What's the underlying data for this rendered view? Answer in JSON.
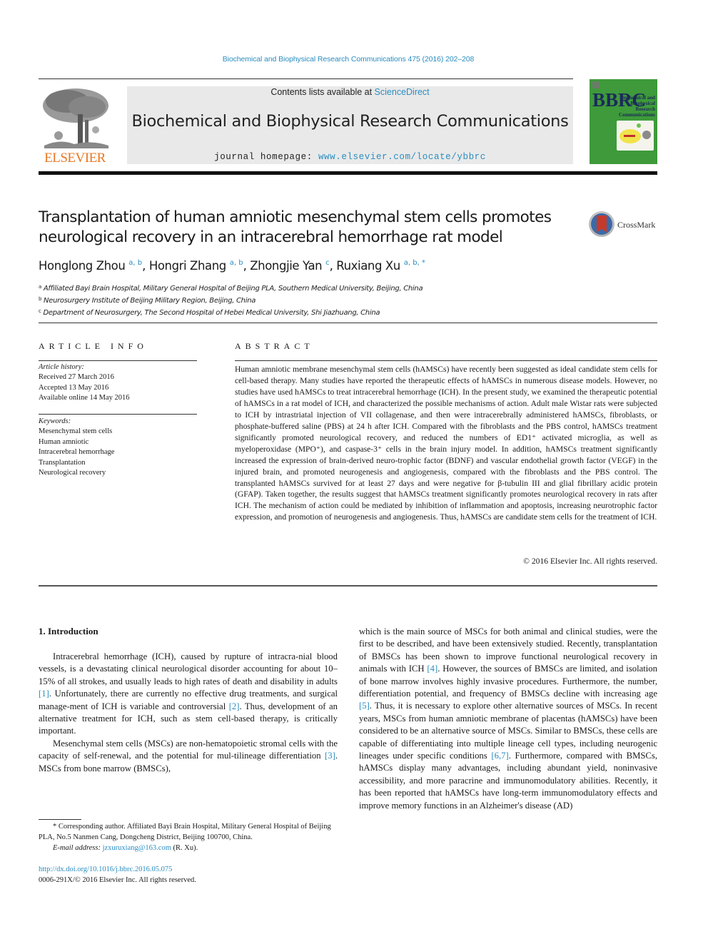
{
  "header": {
    "journal_ref": "Biochemical and Biophysical Research Communications 475 (2016) 202–208",
    "publisher_logo_text": "ELSEVIER",
    "contents_prefix": "Contents lists available at ",
    "contents_link": "ScienceDirect",
    "journal_name": "Biochemical and Biophysical Research Communications",
    "homepage_prefix": "journal homepage: ",
    "homepage_link": "www.elsevier.com/locate/ybbrc",
    "cover": {
      "letters": "BBRC",
      "title_lines": [
        "Biochemical and",
        "Biophysical",
        "Research",
        "Communications"
      ]
    },
    "colors": {
      "link": "#2a8dc0",
      "elsevier_orange": "#e87722",
      "cover_green": "#3e9a3a",
      "masthead_gray": "#e9e9e9"
    }
  },
  "article": {
    "title": "Transplantation of human amniotic mesenchymal stem cells promotes neurological recovery in an intracerebral hemorrhage rat model",
    "crossmark_label": "CrossMark",
    "authors": [
      {
        "name": "Honglong Zhou",
        "sup": "a, b"
      },
      {
        "name": "Hongri Zhang",
        "sup": "a, b"
      },
      {
        "name": "Zhongjie Yan",
        "sup": "c"
      },
      {
        "name": "Ruxiang Xu",
        "sup": "a, b, *"
      }
    ],
    "affiliations": [
      {
        "key": "a",
        "text": "Affiliated Bayi Brain Hospital, Military General Hospital of Beijing PLA, Southern Medical University, Beijing, China"
      },
      {
        "key": "b",
        "text": "Neurosurgery Institute of Beijing Military Region, Beijing, China"
      },
      {
        "key": "c",
        "text": "Department of Neurosurgery, The Second Hospital of Hebei Medical University, Shi Jiazhuang, China"
      }
    ]
  },
  "article_info": {
    "label": "ARTICLE INFO",
    "history_label": "Article history:",
    "history": [
      "Received 27 March 2016",
      "Accepted 13 May 2016",
      "Available online 14 May 2016"
    ],
    "keywords_label": "Keywords:",
    "keywords": [
      "Mesenchymal stem cells",
      "Human amniotic",
      "Intracerebral hemorrhage",
      "Transplantation",
      "Neurological recovery"
    ]
  },
  "abstract": {
    "label": "ABSTRACT",
    "text": "Human amniotic membrane mesenchymal stem cells (hAMSCs) have recently been suggested as ideal candidate stem cells for cell-based therapy. Many studies have reported the therapeutic effects of hAMSCs in numerous disease models. However, no studies have used hAMSCs to treat intracerebral hemorrhage (ICH). In the present study, we examined the therapeutic potential of hAMSCs in a rat model of ICH, and characterized the possible mechanisms of action. Adult male Wistar rats were subjected to ICH by intrastriatal injection of VII collagenase, and then were intracerebrally administered hAMSCs, fibroblasts, or phosphate-buffered saline (PBS) at 24 h after ICH. Compared with the fibroblasts and the PBS control, hAMSCs treatment significantly promoted neurological recovery, and reduced the numbers of ED1⁺ activated microglia, as well as myeloperoxidase (MPO⁺), and caspase-3⁺ cells in the brain injury model. In addition, hAMSCs treatment significantly increased the expression of brain-derived neuro-trophic factor (BDNF) and vascular endothelial growth factor (VEGF) in the injured brain, and promoted neurogenesis and angiogenesis, compared with the fibroblasts and the PBS control. The transplanted hAMSCs survived for at least 27 days and were negative for β-tubulin III and glial fibrillary acidic protein (GFAP). Taken together, the results suggest that hAMSCs treatment significantly promotes neurological recovery in rats after ICH. The mechanism of action could be mediated by inhibition of inflammation and apoptosis, increasing neurotrophic factor expression, and promotion of neurogenesis and angiogenesis. Thus, hAMSCs are candidate stem cells for the treatment of ICH.",
    "copyright": "© 2016 Elsevier Inc. All rights reserved."
  },
  "body": {
    "section_heading": "1.  Introduction",
    "left_col": {
      "p1_a": "Intracerebral hemorrhage (ICH), caused by rupture of intracra-nial blood vessels, is a devastating clinical neurological disorder accounting for about 10–15% of all strokes, and usually leads to high rates of death and disability in adults ",
      "ref1": "[1]",
      "p1_b": ". Unfortunately, there are currently no effective drug treatments, and surgical manage-ment of ICH is variable and controversial ",
      "ref2": "[2]",
      "p1_c": ". Thus, development of an alternative treatment for ICH, such as stem cell-based therapy, is critically important.",
      "p2_a": "Mesenchymal stem cells (MSCs) are non-hematopoietic stromal cells with the capacity of self-renewal, and the potential for mul-tilineage differentiation ",
      "ref3": "[3]",
      "p2_b": ". MSCs from bone marrow (BMSCs),"
    },
    "right_col": {
      "t_a": "which is the main source of MSCs for both animal and clinical studies, were the first to be described, and have been extensively studied. Recently, transplantation of BMSCs has been shown to improve functional neurological recovery in animals with ICH ",
      "ref4": "[4]",
      "t_b": ". However, the sources of BMSCs are limited, and isolation of bone marrow involves highly invasive procedures. Furthermore, the number, differentiation potential, and frequency of BMSCs decline with increasing age ",
      "ref5": "[5]",
      "t_c": ". Thus, it is necessary to explore other alternative sources of MSCs. In recent years, MSCs from human amniotic membrane of placentas (hAMSCs) have been considered to be an alternative source of MSCs. Similar to BMSCs, these cells are capable of differentiating into multiple lineage cell types, including neurogenic lineages under specific conditions ",
      "ref67": "[6,7]",
      "t_d": ". Furthermore, compared with BMSCs, hAMSCs display many advantages, including abundant yield, noninvasive accessibility, and more paracrine and immunomodulatory abilities. Recently, it has been reported that hAMSCs have long-term immunomodulatory effects and improve memory functions in an Alzheimer's disease (AD)"
    }
  },
  "footnotes": {
    "corresponding": "* Corresponding author. Affiliated Bayi Brain Hospital, Military General Hospital of Beijing PLA, No.5 Nanmen Cang, Dongcheng District, Beijing 100700, China.",
    "email_label": "E-mail address: ",
    "email": "jzxuruxiang@163.com",
    "email_suffix": " (R. Xu).",
    "doi": "http://dx.doi.org/10.1016/j.bbrc.2016.05.075",
    "issn": "0006-291X/© 2016 Elsevier Inc. All rights reserved."
  }
}
